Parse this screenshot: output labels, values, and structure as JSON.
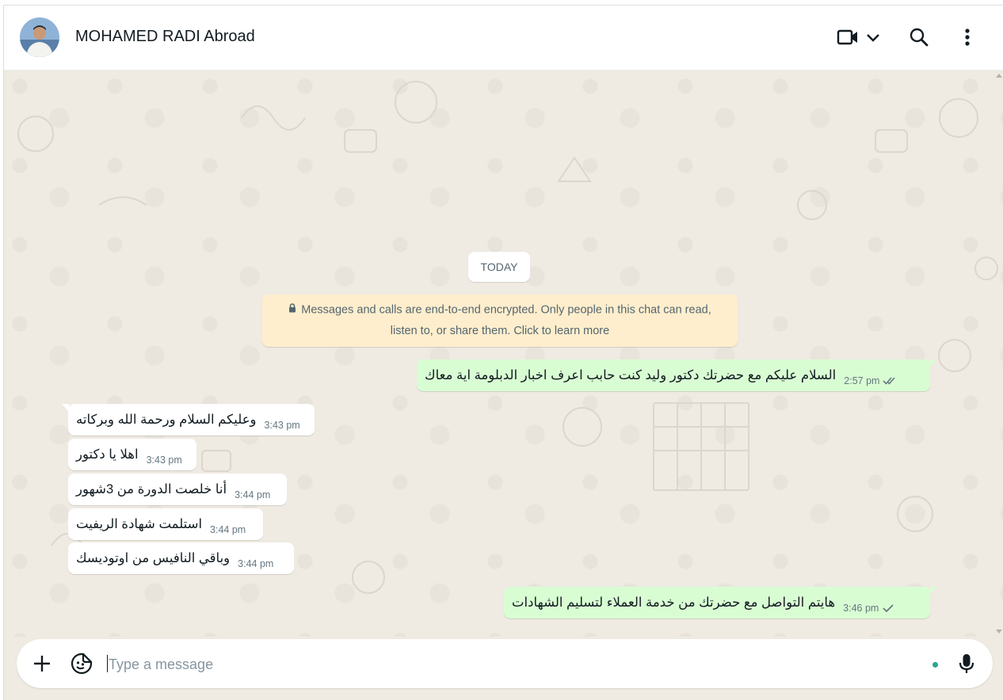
{
  "header": {
    "contact_name": "MOHAMED RADI Abroad",
    "icons": [
      "video-call-icon",
      "chevron-down-icon",
      "search-icon",
      "menu-icon"
    ]
  },
  "chat": {
    "date_label": "TODAY",
    "encryption_notice_line1": "Messages and calls are end-to-end encrypted. Only people in this chat can read,",
    "encryption_notice_line2": "listen to, or share them. Click to learn more",
    "messages": [
      {
        "direction": "out",
        "text": "السلام عليكم مع حضرتك دكتور وليد كنت حابب اعرف اخبار الدبلومة اية معاك",
        "time": "2:57 pm",
        "status": "read"
      },
      {
        "direction": "in",
        "text": "وعليكم السلام ورحمة الله وبركاته",
        "time": "3:43 pm"
      },
      {
        "direction": "in",
        "text": "اهلا يا دكتور",
        "time": "3:43 pm"
      },
      {
        "direction": "in",
        "text": "أنا خلصت الدورة من 3شهور",
        "time": "3:44 pm"
      },
      {
        "direction": "in",
        "text": "استلمت شهادة الريفيت",
        "time": "3:44 pm"
      },
      {
        "direction": "in",
        "text": "وباقي النافيس من اوتوديسك",
        "time": "3:44 pm"
      },
      {
        "direction": "out",
        "text": "هايتم التواصل مع حضرتك من خدمة العملاء لتسليم الشهادات",
        "time": "3:46 pm",
        "status": "sent"
      }
    ]
  },
  "composer": {
    "placeholder": "Type a message",
    "value": ""
  },
  "colors": {
    "chat_background": "#efeae2",
    "outgoing_bubble": "#d9fdd3",
    "incoming_bubble": "#ffffff",
    "encryption_notice": "#ffeecd",
    "read_tick": "#667781"
  }
}
